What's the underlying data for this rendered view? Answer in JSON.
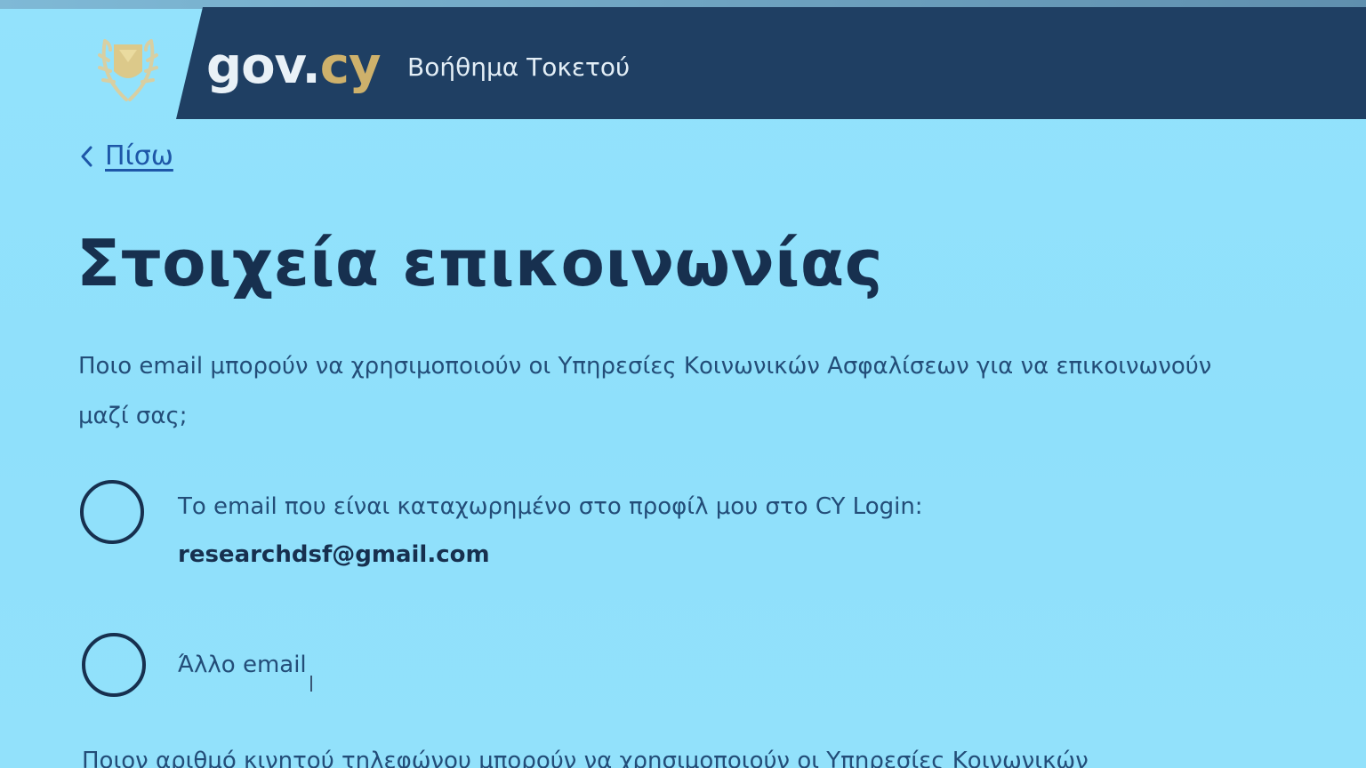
{
  "header": {
    "logo_gov": "gov",
    "logo_dot": ".",
    "logo_cy": "cy",
    "service_name": "Βοήθημα Τοκετού"
  },
  "nav": {
    "back_label": "Πίσω"
  },
  "main": {
    "title": "Στοιχεία επικοινωνίας",
    "email_question": "Ποιο email μπορούν να χρησιμοποιούν οι Υπηρεσίες Κοινωνικών Ασφαλίσεων για να επικοινωνούν μαζί σας;",
    "options": [
      {
        "label": "Το email που είναι καταχωρημένο στο προφίλ μου στο CY Login:",
        "value": "researchdsf@gmail.com"
      },
      {
        "label": "Άλλο email"
      }
    ],
    "phone_question": "Ποιον αριθμό κινητού τηλεφώνου μπορούν να χρησιμοποιούν οι Υπηρεσίες Κοινωνικών"
  },
  "colors": {
    "background": "#8fe0fb",
    "header": "#1f3f63",
    "brand_gold": "#ceb16b",
    "link": "#1e57a8",
    "text_dark": "#17304f"
  }
}
